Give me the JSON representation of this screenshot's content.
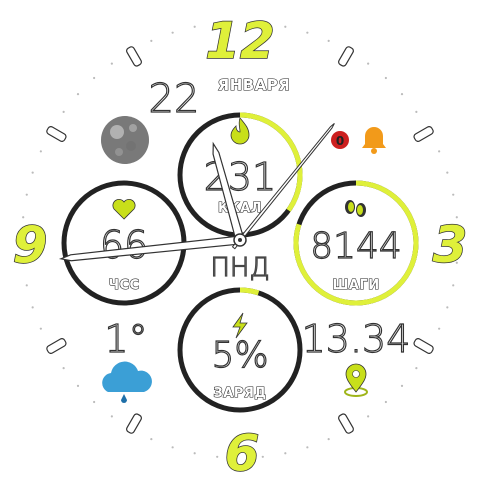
{
  "numerals": {
    "twelve": "12",
    "three": "3",
    "six": "6",
    "nine": "9"
  },
  "date": {
    "day": "22",
    "month": "ЯНВАРЯ"
  },
  "weekday": "ПНД",
  "calories": {
    "value": "231",
    "label": "ККАЛ",
    "progress": 0.35
  },
  "heart_rate": {
    "value": "66",
    "label": "ЧСС"
  },
  "steps": {
    "value": "8144",
    "label": "ШАГИ",
    "progress": 0.8
  },
  "battery": {
    "value": "5%",
    "label": "ЗАРЯД",
    "progress": 0.05
  },
  "weather": {
    "temperature": "1°",
    "icon": "cloud-rain-icon"
  },
  "location_time": {
    "time": "13.34",
    "icon": "map-pin-icon"
  },
  "moon_phase": {
    "icon": "moon-icon"
  },
  "notifications": {
    "count": "0",
    "alarm_icon": "bell-icon"
  },
  "colors": {
    "accent": "#dff03a",
    "accent_dark": "#b7cc14",
    "ring": "#222222",
    "red": "#cc1f1f",
    "orange": "#f29a1a",
    "blue": "#3b9fd6"
  },
  "hands": {
    "hour": 10,
    "minute": 9,
    "second": 0
  }
}
